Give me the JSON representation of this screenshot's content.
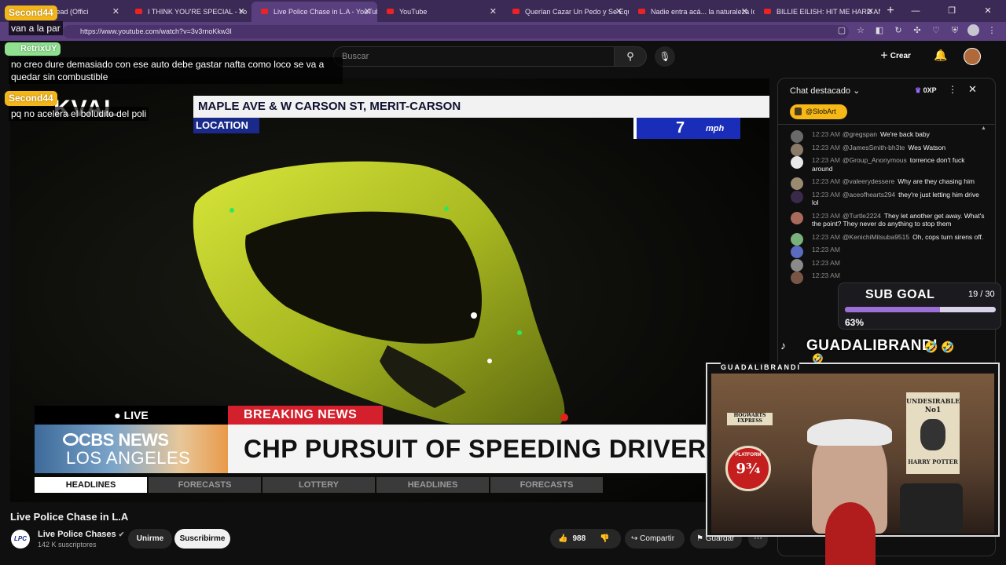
{
  "browser": {
    "tabs": [
      {
        "label": "go - drop dead (Offici",
        "active": false
      },
      {
        "label": "I THINK YOU'RE SPECIAL - Yo",
        "active": false
      },
      {
        "label": "Live Police Chase in L.A - YouTube",
        "active": true
      },
      {
        "label": "YouTube",
        "active": false
      },
      {
        "label": "Querían Cazar Un Pedo y Se Equiv",
        "active": false
      },
      {
        "label": "Nadie entra acá... la naturaleza lo",
        "active": false
      },
      {
        "label": "BILLIE EILISH: HIT ME HARD AND",
        "active": false
      }
    ],
    "url": "https://www.youtube.com/watch?v=3v3rnoKkw3I"
  },
  "header": {
    "search_placeholder": "Buscar",
    "create_label": "Crear"
  },
  "video": {
    "location_street": "MAPLE AVE & W CARSON ST, MERIT-CARSON",
    "location_tag": "LOCATION",
    "speed_value": "7",
    "speed_unit": "mph",
    "station_partial": "KVAL",
    "live_label": "LIVE",
    "breaking_label": "BREAKING NEWS",
    "network_line1": "CBS NEWS",
    "network_line2": "LOS ANGELES",
    "headline": "CHP PURSUIT OF SPEEDING DRIVER",
    "ticker": [
      "HEADLINES",
      "FORECASTS",
      "LOTTERY",
      "HEADLINES",
      "FORECASTS"
    ]
  },
  "below": {
    "title": "Live Police Chase in L.A",
    "channel_logo_text": "LPC",
    "channel_name": "Live Police Chases",
    "subscribers": "142 K suscriptores",
    "join_label": "Unirme",
    "subscribe_label": "Suscribirme",
    "like_count": "988",
    "share_label": "Compartir",
    "save_label": "Guardar"
  },
  "chat": {
    "title": "Chat destacado",
    "xp": "0XP",
    "pinned_user": "@SlobArt",
    "messages": [
      {
        "time": "12:23 AM",
        "user": "@gregspan",
        "text": "We're back baby"
      },
      {
        "time": "12:23 AM",
        "user": "@JamesSmith-bh3te",
        "text": "Wes Watson"
      },
      {
        "time": "12:23 AM",
        "user": "@Group_Anonymous",
        "text": "torrence don't fuck around"
      },
      {
        "time": "12:23 AM",
        "user": "@valeerydessere",
        "text": "Why are they chasing him"
      },
      {
        "time": "12:23 AM",
        "user": "@aceofhearts294",
        "text": "they're just letting him drive lol"
      },
      {
        "time": "12:23 AM",
        "user": "@Turtle2224",
        "text": "They let another get away. What's the point? They never do anything to stop them"
      },
      {
        "time": "12:23 AM",
        "user": "@KenichiMitsuba9515",
        "text": "Oh, cops turn sirens off."
      },
      {
        "time": "12:23 AM",
        "user": "",
        "text": ""
      },
      {
        "time": "12:23 AM",
        "user": "",
        "text": ""
      },
      {
        "time": "12:23 AM",
        "user": "",
        "text": ""
      }
    ]
  },
  "overlay": {
    "sub_goal_title": "SUB GOAL",
    "sub_goal_count": "19 / 30",
    "sub_goal_progress": 0.63,
    "sub_goal_percent": "63%",
    "streamer_name": "GUADALIBRANDI",
    "cam_label": "GUADALIBRANDI",
    "poster_line1": "UNDESIRABLE",
    "poster_line2": "No1",
    "poster_line3": "HARRY POTTER",
    "sign_text": "HOGWARTS EXPRESS",
    "platform_label": "PLATFORM",
    "platform_number": "9¾",
    "emojis": "🤣 🤣",
    "emoji_small": "🤣",
    "chat_overlay": [
      {
        "user": "Second44",
        "text": "van a la par"
      },
      {
        "user": "RetrixUY",
        "text": "no creo dure demasiado con ese auto debe gastar nafta como loco se va a quedar sin combustible"
      },
      {
        "user": "Second44",
        "text": "pq no acelera el boludito del poli"
      }
    ]
  }
}
